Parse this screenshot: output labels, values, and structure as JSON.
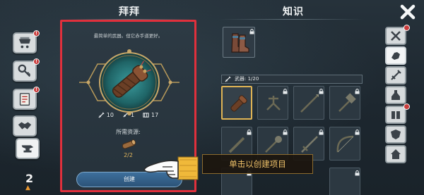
{
  "left_bar": {
    "items": [
      {
        "name": "cart-icon",
        "badge": "!"
      },
      {
        "name": "key-icon",
        "badge": "!"
      },
      {
        "name": "scroll-icon",
        "badge": "!"
      },
      {
        "name": "handshake-icon",
        "badge": ""
      },
      {
        "name": "anvil-icon",
        "badge": ""
      }
    ],
    "level": "2",
    "level_icon": "level-up-icon"
  },
  "craft": {
    "title": "拜拜",
    "description": "最简单的武器。但它赤手道更好。",
    "stats": [
      {
        "icon": "sword-stat-icon",
        "value": "10"
      },
      {
        "icon": "dagger-stat-icon",
        "value": "1"
      },
      {
        "icon": "durability-stat-icon",
        "value": "17"
      }
    ],
    "required_label": "所需资源:",
    "required_count": "2/2",
    "create_label": "创建"
  },
  "knowledge": {
    "title": "知识",
    "category_label": "武器: 1/20"
  },
  "tutorial": {
    "tip": "单击以创建项目"
  },
  "colors": {
    "highlight_border": "#e0303c",
    "selected_cell": "#e0b455",
    "tip_text": "#f1c36a",
    "badge": "#c93c3c"
  }
}
